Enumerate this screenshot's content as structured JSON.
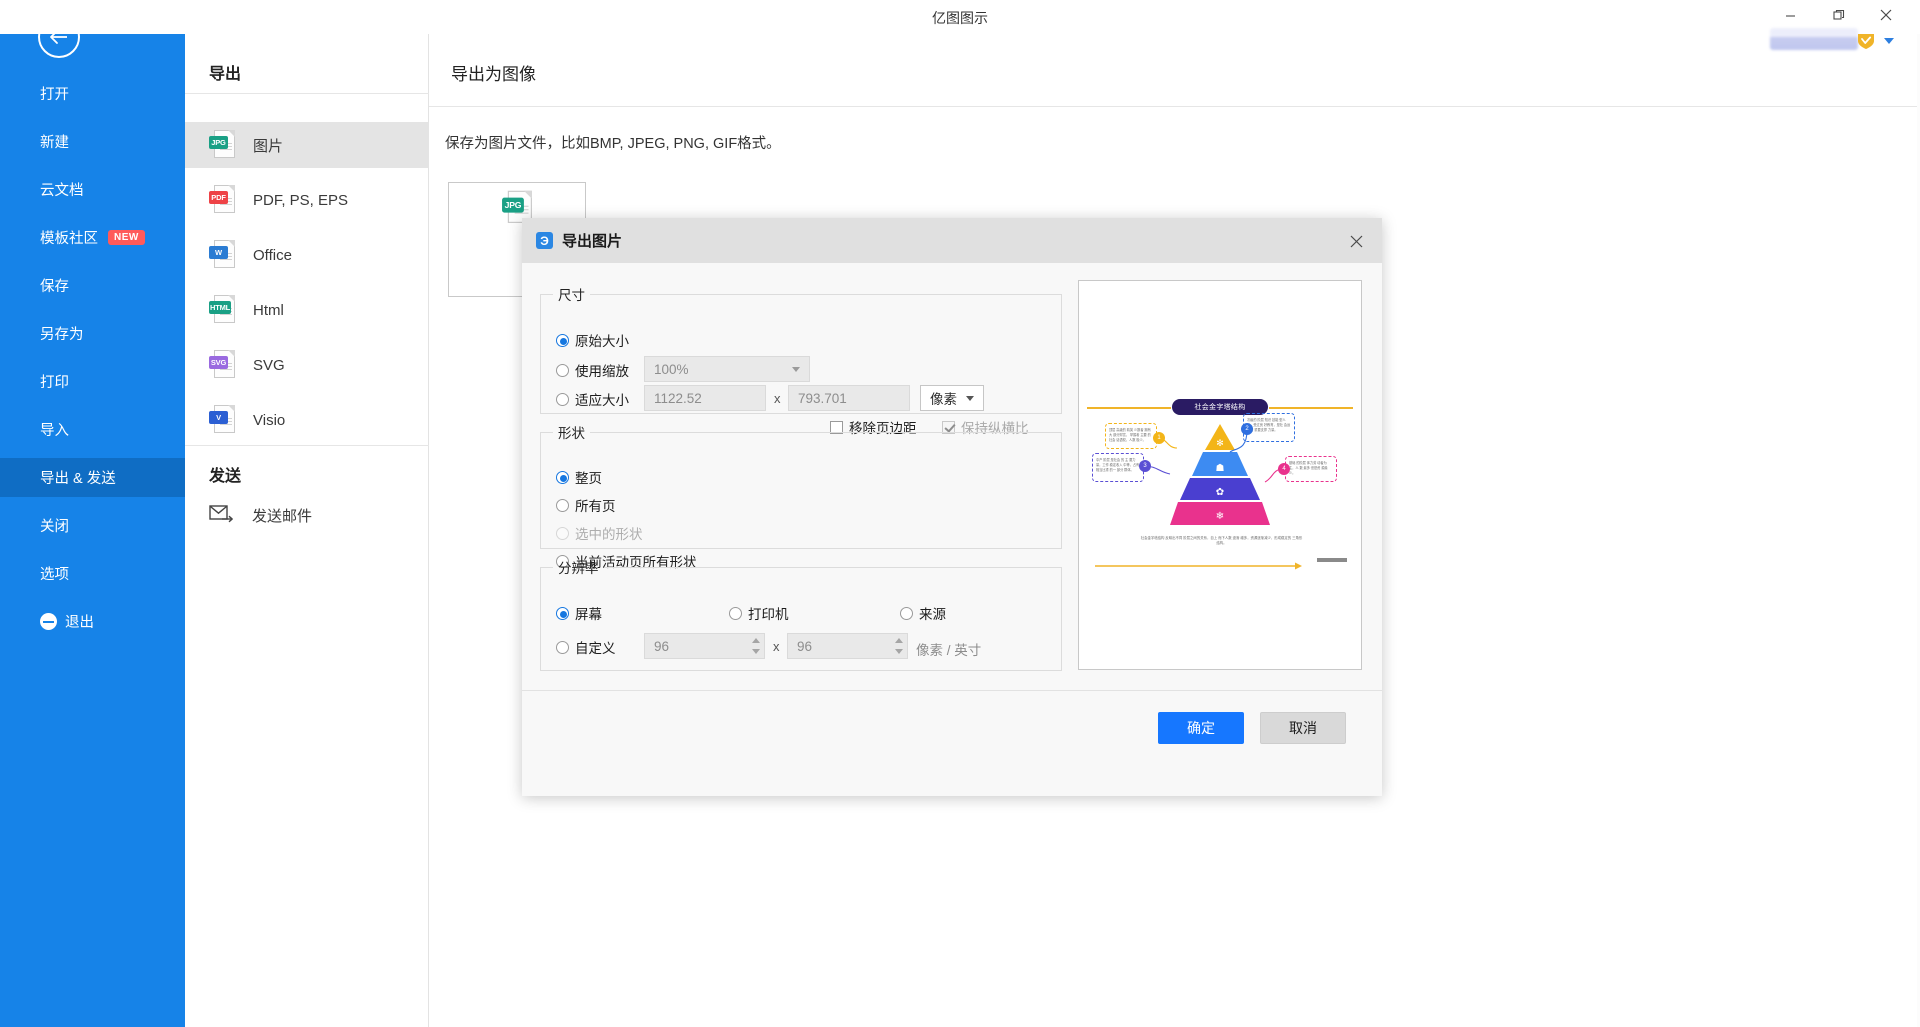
{
  "window": {
    "app_title": "亿图图示",
    "minimize": "—",
    "maximize": "❐",
    "close": "✕"
  },
  "leftnav": {
    "back_icon": "back-arrow-icon",
    "items": [
      {
        "label": "打开",
        "badge": null,
        "active": false
      },
      {
        "label": "新建",
        "badge": null,
        "active": false
      },
      {
        "label": "云文档",
        "badge": null,
        "active": false
      },
      {
        "label": "模板社区",
        "badge": "NEW",
        "active": false
      },
      {
        "label": "保存",
        "badge": null,
        "active": false
      },
      {
        "label": "另存为",
        "badge": null,
        "active": false
      },
      {
        "label": "打印",
        "badge": null,
        "active": false
      },
      {
        "label": "导入",
        "badge": null,
        "active": false
      },
      {
        "label": "导出 & 发送",
        "badge": null,
        "active": true
      },
      {
        "label": "关闭",
        "badge": null,
        "active": false
      },
      {
        "label": "选项",
        "badge": null,
        "active": false
      }
    ],
    "quit_label": "退出",
    "accent": "#1683e8",
    "active_bg": "#0f6dc4"
  },
  "midcol": {
    "export_head": "导出",
    "send_head": "发送",
    "formats": [
      {
        "label": "图片",
        "chip": "JPG",
        "chip_color": "#1aa085",
        "selected": true
      },
      {
        "label": "PDF, PS, EPS",
        "chip": "PDF",
        "chip_color": "#ee4246",
        "selected": false
      },
      {
        "label": "Office",
        "chip": "W",
        "chip_color": "#2b7cd3",
        "selected": false
      },
      {
        "label": "Html",
        "chip": "HTML",
        "chip_color": "#1aa085",
        "selected": false
      },
      {
        "label": "SVG",
        "chip": "SVG",
        "chip_color": "#9a6ae0",
        "selected": false
      },
      {
        "label": "Visio",
        "chip": "V",
        "chip_color": "#2b5fd3",
        "selected": false
      }
    ],
    "send_item": "发送邮件"
  },
  "main": {
    "title": "导出为图像",
    "description": "保存为图片文件，比如BMP, JPEG, PNG, GIF格式。",
    "card_chip": "JPG"
  },
  "dialog": {
    "title": "导出图片",
    "app_icon_glyph": "Э",
    "close": "✕",
    "size_group": {
      "legend": "尺寸",
      "original": {
        "label": "原始大小",
        "checked": true
      },
      "scale": {
        "label": "使用缩放",
        "checked": false,
        "value": "100%"
      },
      "fit": {
        "label": "适应大小",
        "checked": false,
        "width": "1122.52",
        "height": "793.701",
        "separator": "x",
        "unit": "像素"
      },
      "remove_margin": {
        "label": "移除页边距",
        "checked": false,
        "disabled": false
      },
      "keep_ratio": {
        "label": "保持纵横比",
        "checked": true,
        "disabled": true
      }
    },
    "shape_group": {
      "legend": "形状",
      "options": [
        {
          "label": "整页",
          "checked": true,
          "disabled": false
        },
        {
          "label": "所有页",
          "checked": false,
          "disabled": false
        },
        {
          "label": "选中的形状",
          "checked": false,
          "disabled": true
        },
        {
          "label": "当前活动页所有形状",
          "checked": false,
          "disabled": false
        }
      ]
    },
    "resolution_group": {
      "legend": "分辨率",
      "options": [
        {
          "label": "屏幕",
          "checked": true
        },
        {
          "label": "打印机",
          "checked": false
        },
        {
          "label": "来源",
          "checked": false
        }
      ],
      "custom": {
        "label": "自定义",
        "checked": false,
        "x_value": "96",
        "y_value": "96",
        "separator": "x",
        "unit": "像素 / 英寸"
      }
    },
    "buttons": {
      "ok": "确定",
      "cancel": "取消"
    },
    "accent": "#1677ff"
  },
  "preview": {
    "diagram_title": "社会金字塔结构",
    "callouts": [
      {
        "num": "1",
        "color": "#f3b518",
        "text": "顶层 高级的 精英 少数者 拥有大 部分财富， 掌握着 主要 的社会 话语权，人数 极少。"
      },
      {
        "num": "2",
        "color": "#2f6fe0",
        "text": "次级的 阶层 知识 技能 型人才，受过良 好教育，是社 会运转的 重要支撑 力量。"
      },
      {
        "num": "3",
        "color": "#5a4fd4",
        "text": "中产 阶层 是社会 的 主 要力量，工作 稳定收入 中等，占有 相当比重 的一 部分 群体。"
      },
      {
        "num": "4",
        "color": "#e9328d",
        "text": "基础 的阶层 体力劳 动者为主，人 数 最多 但是资 源最少。"
      }
    ],
    "tiers": [
      {
        "color": "#f3b518",
        "icon": "★"
      },
      {
        "color": "#3d8bf2",
        "icon": "✎"
      },
      {
        "color": "#4a3fd0",
        "icon": "✿"
      },
      {
        "color": "#e9328d",
        "icon": "❄"
      }
    ],
    "footnote": "社会金字塔结构 反映出不同 阶层之间的关系，自上 而下人数 逐渐 增多，资源逐渐减少，形成稳定的 三角形 结构。"
  }
}
